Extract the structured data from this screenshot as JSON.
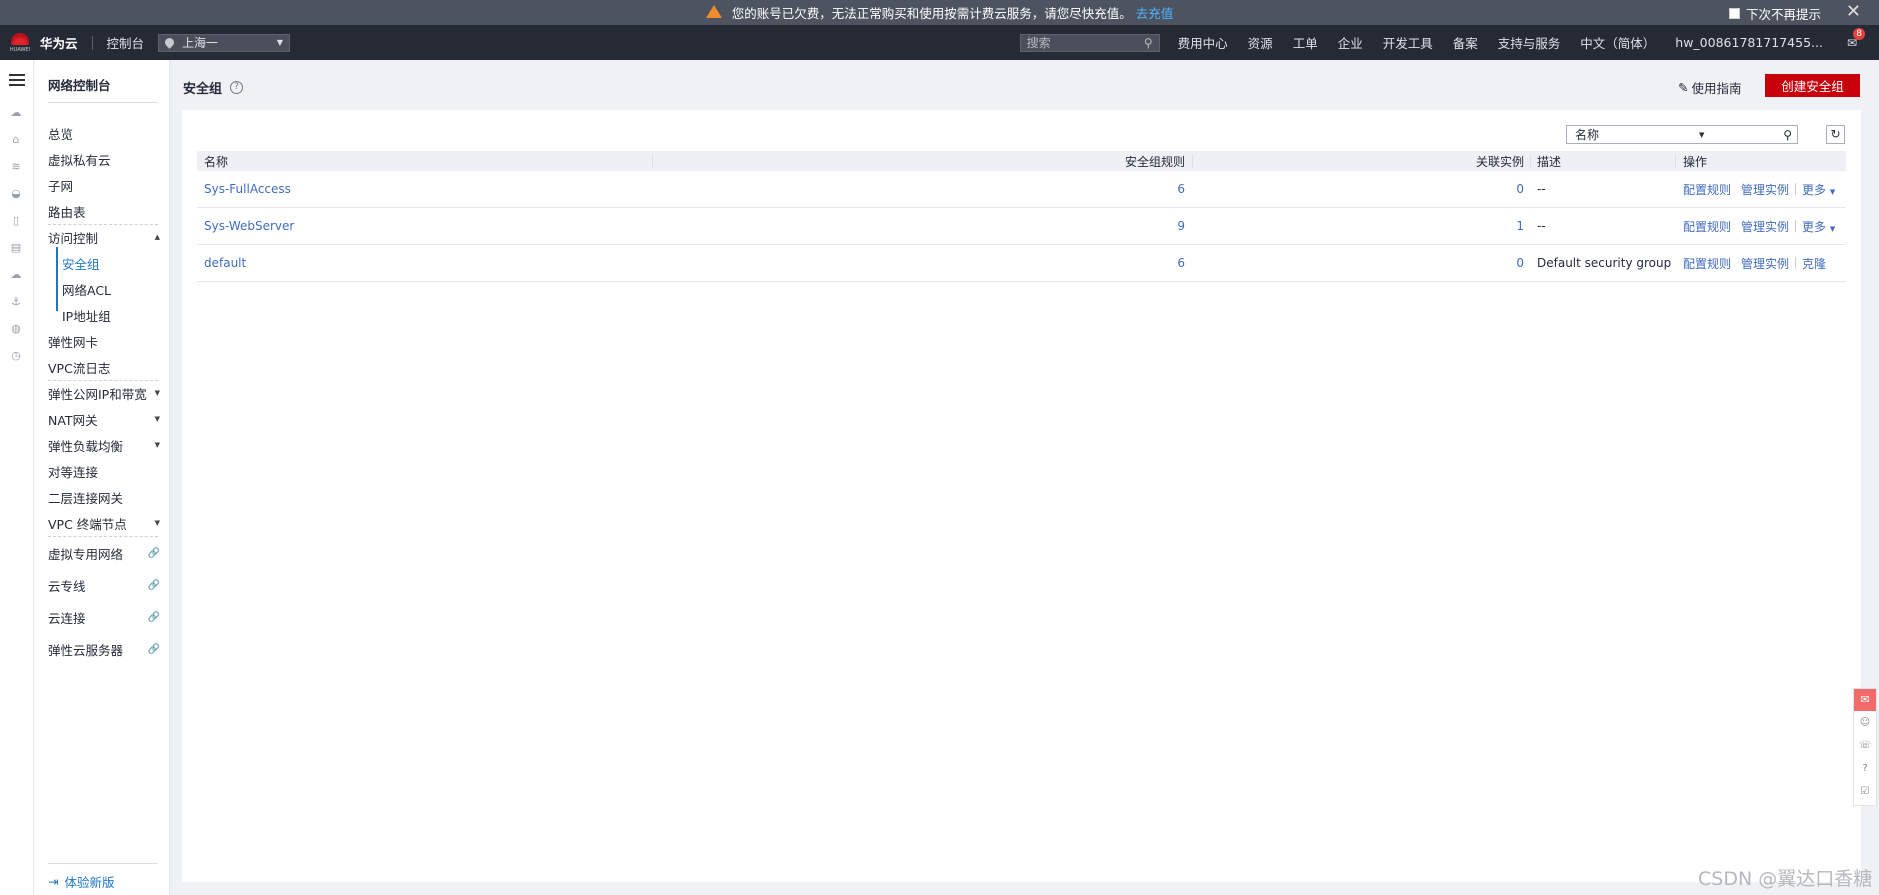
{
  "banner": {
    "message": "您的账号已欠费，无法正常购买和使用按需计费云服务，请您尽快充值。",
    "link": "去充值",
    "dismiss": "下次不再提示",
    "close": "✕"
  },
  "topnav": {
    "brand": "华为云",
    "logo_text": "HUAWEI",
    "console": "控制台",
    "region": "上海一",
    "search_placeholder": "搜索",
    "items": [
      "费用中心",
      "资源",
      "工单",
      "企业",
      "开发工具",
      "备案",
      "支持与服务",
      "中文（简体）",
      "hw_00861781717455..."
    ],
    "mail_badge": "8"
  },
  "sidebar": {
    "title": "网络控制台",
    "items": [
      {
        "label": "总览"
      },
      {
        "label": "虚拟私有云"
      },
      {
        "label": "子网"
      },
      {
        "label": "路由表"
      },
      {
        "label": "访问控制"
      },
      {
        "label": "安全组"
      },
      {
        "label": "网络ACL"
      },
      {
        "label": "IP地址组"
      },
      {
        "label": "弹性网卡"
      },
      {
        "label": "VPC流日志"
      },
      {
        "label": "弹性公网IP和带宽"
      },
      {
        "label": "NAT网关"
      },
      {
        "label": "弹性负载均衡"
      },
      {
        "label": "对等连接"
      },
      {
        "label": "二层连接网关"
      },
      {
        "label": "VPC 终端节点"
      },
      {
        "label": "虚拟专用网络"
      },
      {
        "label": "云专线"
      },
      {
        "label": "云连接"
      },
      {
        "label": "弹性云服务器"
      }
    ],
    "bottom": "体验新版"
  },
  "main": {
    "title": "安全组",
    "guide": "使用指南",
    "create_button": "创建安全组",
    "filter_label": "名称",
    "table": {
      "headers": [
        "名称",
        "安全组规则",
        "关联实例",
        "描述",
        "操作"
      ],
      "rows": [
        {
          "name": "Sys-FullAccess",
          "rules": "6",
          "instances": "0",
          "desc": "--",
          "op1": "配置规则",
          "op2": "管理实例",
          "op3": "更多"
        },
        {
          "name": "Sys-WebServer",
          "rules": "9",
          "instances": "1",
          "desc": "--",
          "op1": "配置规则",
          "op2": "管理实例",
          "op3": "更多"
        },
        {
          "name": "default",
          "rules": "6",
          "instances": "0",
          "desc": "Default security group",
          "op1": "配置规则",
          "op2": "管理实例",
          "op3": "克隆"
        }
      ]
    }
  },
  "watermark": "CSDN @翼达口香糖",
  "colors": {
    "primary_button": "#c7000b",
    "link": "#416bbd",
    "active": "#1e76c8"
  }
}
